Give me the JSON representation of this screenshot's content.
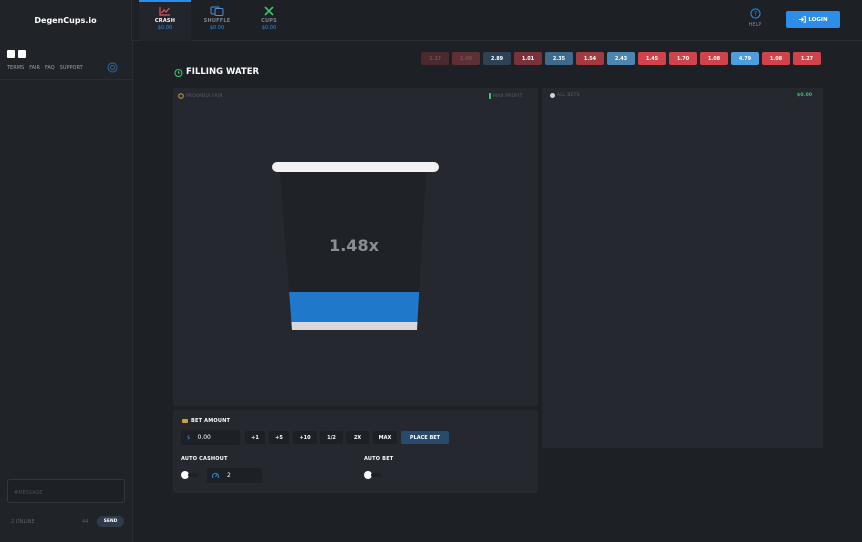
{
  "brand": "DegenCups.io",
  "nav": [
    {
      "label": "CRASH",
      "value": "$0.00",
      "icon": "chart-line-icon"
    },
    {
      "label": "SHUFFLE",
      "value": "$0.00",
      "icon": "cards-icon"
    },
    {
      "label": "CUPS",
      "value": "$0.00",
      "icon": "cross-icon"
    }
  ],
  "help_label": "HELP",
  "login_label": "LOGIN",
  "sidebar": {
    "links": [
      "TERMS",
      "FAIR",
      "FAQ",
      "SUPPORT"
    ],
    "message_placeholder": "#MESSAGE",
    "online": "2 ONLINE",
    "count": "44",
    "send_label": "SEND"
  },
  "game_title": "FILLING WATER",
  "history": [
    {
      "v": "1.1?",
      "color": "#4a2a2e"
    },
    {
      "v": "1.00",
      "color": "#5e2f33"
    },
    {
      "v": "2.89",
      "color": "#2e4256"
    },
    {
      "v": "1.01",
      "color": "#7a3239"
    },
    {
      "v": "2.35",
      "color": "#3e6a8c"
    },
    {
      "v": "1.54",
      "color": "#a23a40"
    },
    {
      "v": "2.43",
      "color": "#4c86b3"
    },
    {
      "v": "1.45",
      "color": "#d2424a"
    },
    {
      "v": "1.70",
      "color": "#d2424a"
    },
    {
      "v": "1.08",
      "color": "#d2424a"
    },
    {
      "v": "4.79",
      "color": "#4d9ee0"
    },
    {
      "v": "1.08",
      "color": "#d2424a"
    },
    {
      "v": "1.27",
      "color": "#d2424a"
    }
  ],
  "game": {
    "provably_fair": "PROVABLY FAIR",
    "max_profit": "MAX PROFIT",
    "multiplier": "1.48x",
    "fill_fraction": 0.2
  },
  "bets": {
    "all_bets": "ALL BETS",
    "total": "$0.00"
  },
  "bet": {
    "label": "BET AMOUNT",
    "currency": "$",
    "amount": "0.00",
    "buttons": [
      "+1",
      "+5",
      "+10",
      "1/2",
      "2X",
      "MAX"
    ],
    "place": "PLACE BET",
    "auto_cashout_label": "AUTO CASHOUT",
    "auto_cashout_value": "2",
    "auto_bet_label": "AUTO BET"
  },
  "colors": {
    "accent": "#2d8ee8",
    "water": "#1f78c9",
    "profit": "#3cc36a"
  }
}
